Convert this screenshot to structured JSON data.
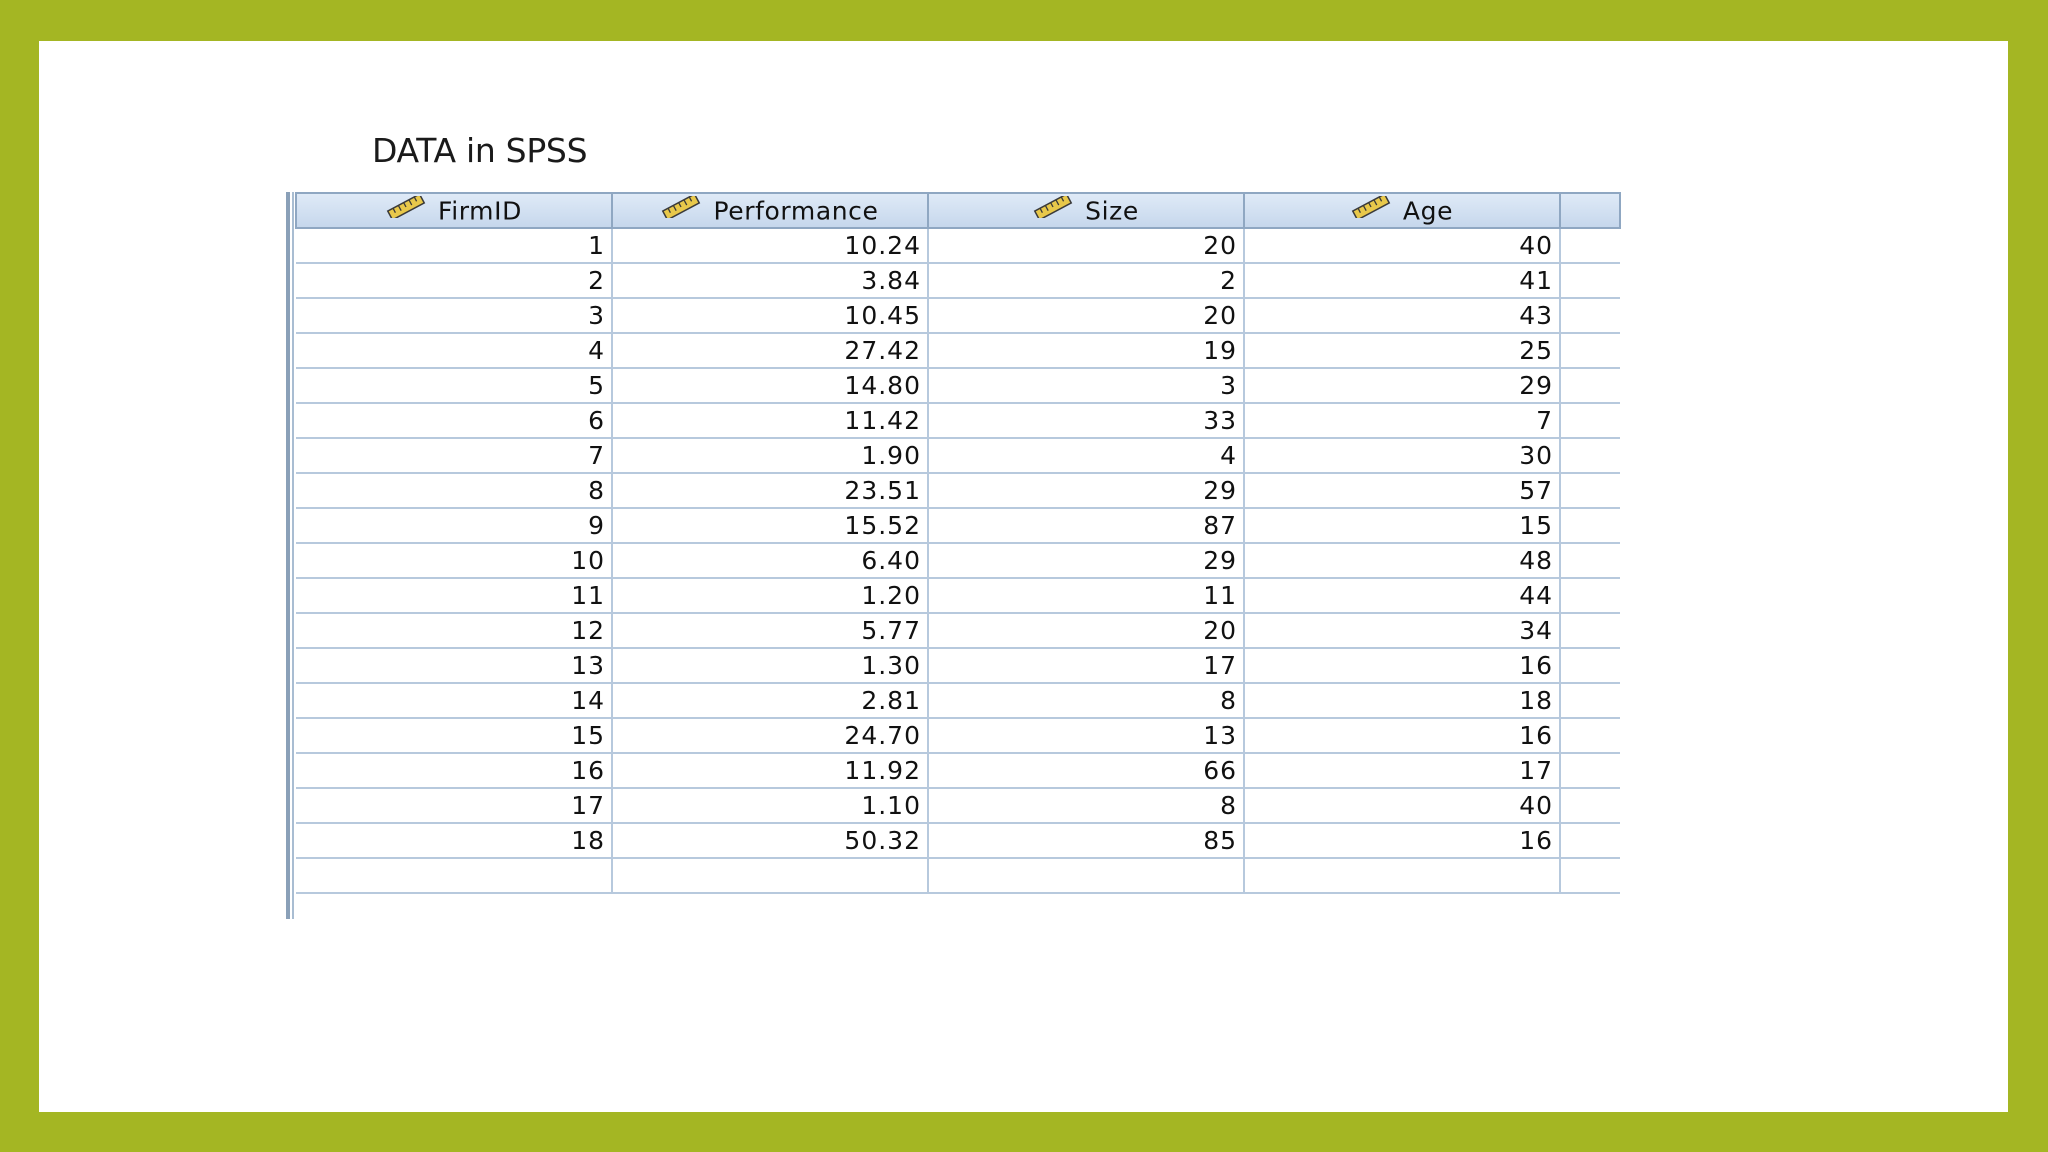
{
  "slide": {
    "title": "DATA in SPSS"
  },
  "grid": {
    "columns": [
      {
        "label": "FirmID",
        "icon": "ruler-icon"
      },
      {
        "label": "Performance",
        "icon": "ruler-icon"
      },
      {
        "label": "Size",
        "icon": "ruler-icon"
      },
      {
        "label": "Age",
        "icon": "ruler-icon"
      }
    ],
    "rows": [
      [
        "1",
        "10.24",
        "20",
        "40"
      ],
      [
        "2",
        "3.84",
        "2",
        "41"
      ],
      [
        "3",
        "10.45",
        "20",
        "43"
      ],
      [
        "4",
        "27.42",
        "19",
        "25"
      ],
      [
        "5",
        "14.80",
        "3",
        "29"
      ],
      [
        "6",
        "11.42",
        "33",
        "7"
      ],
      [
        "7",
        "1.90",
        "4",
        "30"
      ],
      [
        "8",
        "23.51",
        "29",
        "57"
      ],
      [
        "9",
        "15.52",
        "87",
        "15"
      ],
      [
        "10",
        "6.40",
        "29",
        "48"
      ],
      [
        "11",
        "1.20",
        "11",
        "44"
      ],
      [
        "12",
        "5.77",
        "20",
        "34"
      ],
      [
        "13",
        "1.30",
        "17",
        "16"
      ],
      [
        "14",
        "2.81",
        "8",
        "18"
      ],
      [
        "15",
        "24.70",
        "13",
        "16"
      ],
      [
        "16",
        "11.92",
        "66",
        "17"
      ],
      [
        "17",
        "1.10",
        "8",
        "40"
      ],
      [
        "18",
        "50.32",
        "85",
        "16"
      ]
    ],
    "colors": {
      "header_bg": "#c6d7ec",
      "grid_line": "#b7c9dd",
      "frame": "#a4b623"
    }
  }
}
